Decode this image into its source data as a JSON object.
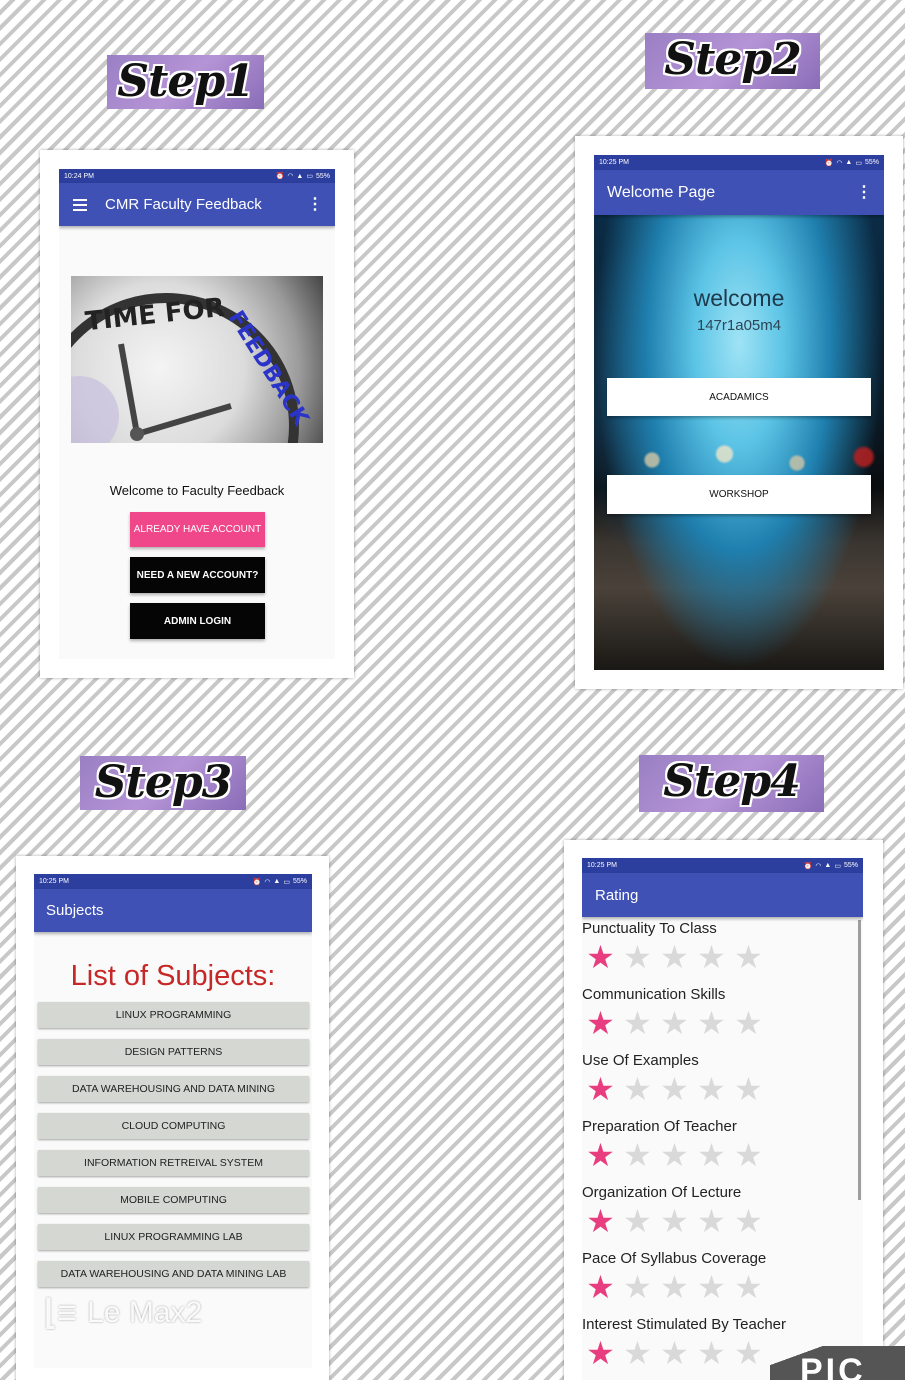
{
  "steps": [
    "Step1",
    "Step2",
    "Step3",
    "Step4"
  ],
  "status": {
    "time1": "10:24 PM",
    "time2": "10:25 PM",
    "battery": "55%",
    "icons": [
      "alarm-icon",
      "wifi-icon",
      "signal-icon",
      "battery-icon"
    ]
  },
  "screen1": {
    "title": "CMR Faculty Feedback",
    "hero_text": [
      "TIME FOR",
      "FEEDBACK"
    ],
    "welcome": "Welcome to Faculty Feedback",
    "btn_login": "ALREADY HAVE ACCOUNT",
    "btn_register": "NEED A NEW ACCOUNT?",
    "btn_admin": "ADMIN LOGIN"
  },
  "screen2": {
    "title": "Welcome Page",
    "welcome": "welcome",
    "user": "147r1a05m4",
    "btn_academics": "ACADAMICS",
    "btn_workshop": "WORKSHOP"
  },
  "screen3": {
    "title": "Subjects",
    "heading": "List of Subjects:",
    "subjects": [
      "LINUX PROGRAMMING",
      "DESIGN PATTERNS",
      "DATA WAREHOUSING AND DATA MINING",
      "CLOUD COMPUTING",
      "INFORMATION RETREIVAL SYSTEM",
      "MOBILE COMPUTING",
      "LINUX PROGRAMMING LAB",
      "DATA WAREHOUSING AND DATA MINING LAB"
    ],
    "watermark": "Le Max2"
  },
  "screen4": {
    "title": "Rating",
    "criteria": [
      {
        "label": "Punctuality To Class",
        "rating": 1,
        "max": 5
      },
      {
        "label": "Communication Skills",
        "rating": 1,
        "max": 5
      },
      {
        "label": "Use Of Examples",
        "rating": 1,
        "max": 5
      },
      {
        "label": "Preparation Of Teacher",
        "rating": 1,
        "max": 5
      },
      {
        "label": "Organization Of Lecture",
        "rating": 1,
        "max": 5
      },
      {
        "label": "Pace Of Syllabus Coverage",
        "rating": 1,
        "max": 5
      },
      {
        "label": "Interest Stimulated By Teacher",
        "rating": 1,
        "max": 5
      }
    ],
    "corner_watermark": "PIC"
  },
  "colors": {
    "primary": "#3f51b5",
    "status_bar": "#2c3e9e",
    "accent_pink": "#f0478a",
    "heading_red": "#c62828",
    "star_on": "#e83e7f",
    "star_off": "#d9d9d9"
  }
}
